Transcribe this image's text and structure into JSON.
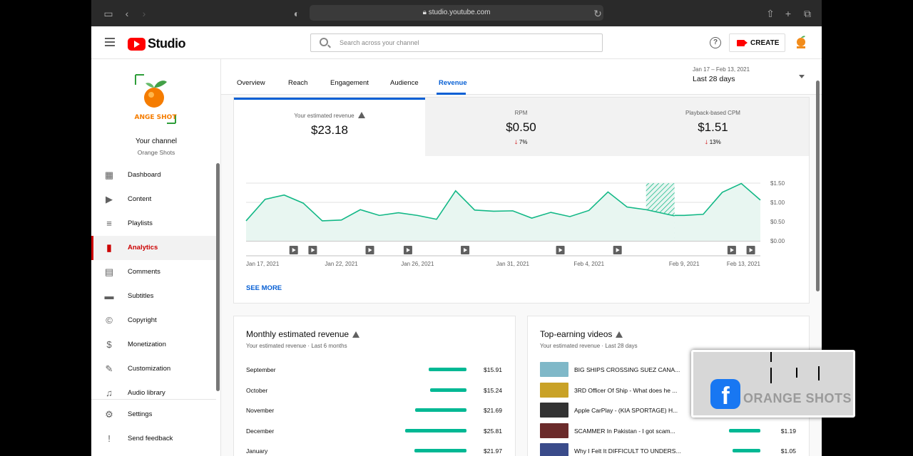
{
  "browser": {
    "url": "studio.youtube.com"
  },
  "header": {
    "logo_text": "Studio",
    "search_placeholder": "Search across your channel",
    "create_label": "CREATE",
    "help_glyph": "?"
  },
  "channel": {
    "title": "Your channel",
    "name": "Orange Shots",
    "logo_text": "ANGE SHOT"
  },
  "sidebar": {
    "items": [
      {
        "label": "Dashboard",
        "icon": "dashboard-icon"
      },
      {
        "label": "Content",
        "icon": "content-icon"
      },
      {
        "label": "Playlists",
        "icon": "playlists-icon"
      },
      {
        "label": "Analytics",
        "icon": "analytics-icon"
      },
      {
        "label": "Comments",
        "icon": "comments-icon"
      },
      {
        "label": "Subtitles",
        "icon": "subtitles-icon"
      },
      {
        "label": "Copyright",
        "icon": "copyright-icon"
      },
      {
        "label": "Monetization",
        "icon": "monetization-icon"
      },
      {
        "label": "Customization",
        "icon": "customization-icon"
      },
      {
        "label": "Audio library",
        "icon": "audio-library-icon"
      }
    ],
    "bottom": [
      {
        "label": "Settings",
        "icon": "settings-icon"
      },
      {
        "label": "Send feedback",
        "icon": "feedback-icon"
      }
    ]
  },
  "tabs": [
    "Overview",
    "Reach",
    "Engagement",
    "Audience",
    "Revenue"
  ],
  "active_tab": "Revenue",
  "date_range": {
    "dates": "Jan 17 – Feb 13, 2021",
    "label": "Last 28 days"
  },
  "metrics": [
    {
      "title": "Your estimated revenue",
      "value": "$23.18",
      "change": ""
    },
    {
      "title": "RPM",
      "value": "$0.50",
      "change": "7%"
    },
    {
      "title": "Playback-based CPM",
      "value": "$1.51",
      "change": "13%"
    }
  ],
  "chart_data": {
    "type": "area",
    "title": "",
    "x_tick_labels": [
      "Jan 17, 2021",
      "Jan 22, 2021",
      "Jan 26, 2021",
      "Jan 31, 2021",
      "Feb 4, 2021",
      "Feb 9, 2021",
      "Feb 13, 2021"
    ],
    "y_tick_labels": [
      "$1.50",
      "$1.00",
      "$0.50",
      "$0.00"
    ],
    "ylim": [
      0,
      1.5
    ],
    "x": [
      "Jan 17",
      "Jan 18",
      "Jan 19",
      "Jan 20",
      "Jan 21",
      "Jan 22",
      "Jan 23",
      "Jan 24",
      "Jan 25",
      "Jan 26",
      "Jan 27",
      "Jan 28",
      "Jan 29",
      "Jan 30",
      "Jan 31",
      "Feb 1",
      "Feb 2",
      "Feb 3",
      "Feb 4",
      "Feb 5",
      "Feb 6",
      "Feb 7",
      "Feb 8",
      "Feb 9",
      "Feb 10",
      "Feb 11",
      "Feb 12",
      "Feb 13"
    ],
    "series": [
      {
        "values": [
          0.52,
          1.08,
          1.19,
          0.98,
          0.52,
          0.54,
          0.81,
          0.66,
          0.73,
          0.66,
          0.56,
          1.3,
          0.8,
          0.77,
          0.78,
          0.59,
          0.74,
          0.63,
          0.79,
          1.27,
          0.88,
          0.81,
          null,
          0.66,
          0.69,
          1.26,
          1.49,
          1.06
        ]
      }
    ],
    "hatched_range": [
      "Feb 7",
      "Feb 8"
    ],
    "video_markers": [
      "Jan 19",
      "Jan 20",
      "Jan 23",
      "Jan 25",
      "Jan 28",
      "Feb 2",
      "Feb 5",
      "Feb 11",
      "Feb 12"
    ],
    "color": "#12b886"
  },
  "see_more": "SEE MORE",
  "monthly": {
    "title": "Monthly estimated revenue",
    "subtitle": "Your estimated revenue · Last 6 months",
    "rows": [
      {
        "label": "September",
        "value": "$15.91",
        "amount": 15.91
      },
      {
        "label": "October",
        "value": "$15.24",
        "amount": 15.24
      },
      {
        "label": "November",
        "value": "$21.69",
        "amount": 21.69
      },
      {
        "label": "December",
        "value": "$25.81",
        "amount": 25.81
      },
      {
        "label": "January",
        "value": "$21.97",
        "amount": 21.97
      }
    ]
  },
  "top_videos": {
    "title": "Top-earning videos",
    "subtitle": "Your estimated revenue · Last 28 days",
    "rows": [
      {
        "title": "BIG SHIPS CROSSING SUEZ CANA...",
        "value": "",
        "amount": 0
      },
      {
        "title": "3RD Officer Of Ship - What does he ...",
        "value": "",
        "amount": 0
      },
      {
        "title": "Apple CarPlay - (KIA SPORTAGE) H...",
        "value": "",
        "amount": 0
      },
      {
        "title": "SCAMMER In Pakistan - I got scam...",
        "value": "$1.19",
        "amount": 1.19
      },
      {
        "title": "Why I Felt It DIFFICULT TO UNDERS...",
        "value": "$1.05",
        "amount": 1.05
      }
    ]
  },
  "overlay": {
    "text": "ORANGE SHOTS",
    "fb_glyph": "f"
  }
}
